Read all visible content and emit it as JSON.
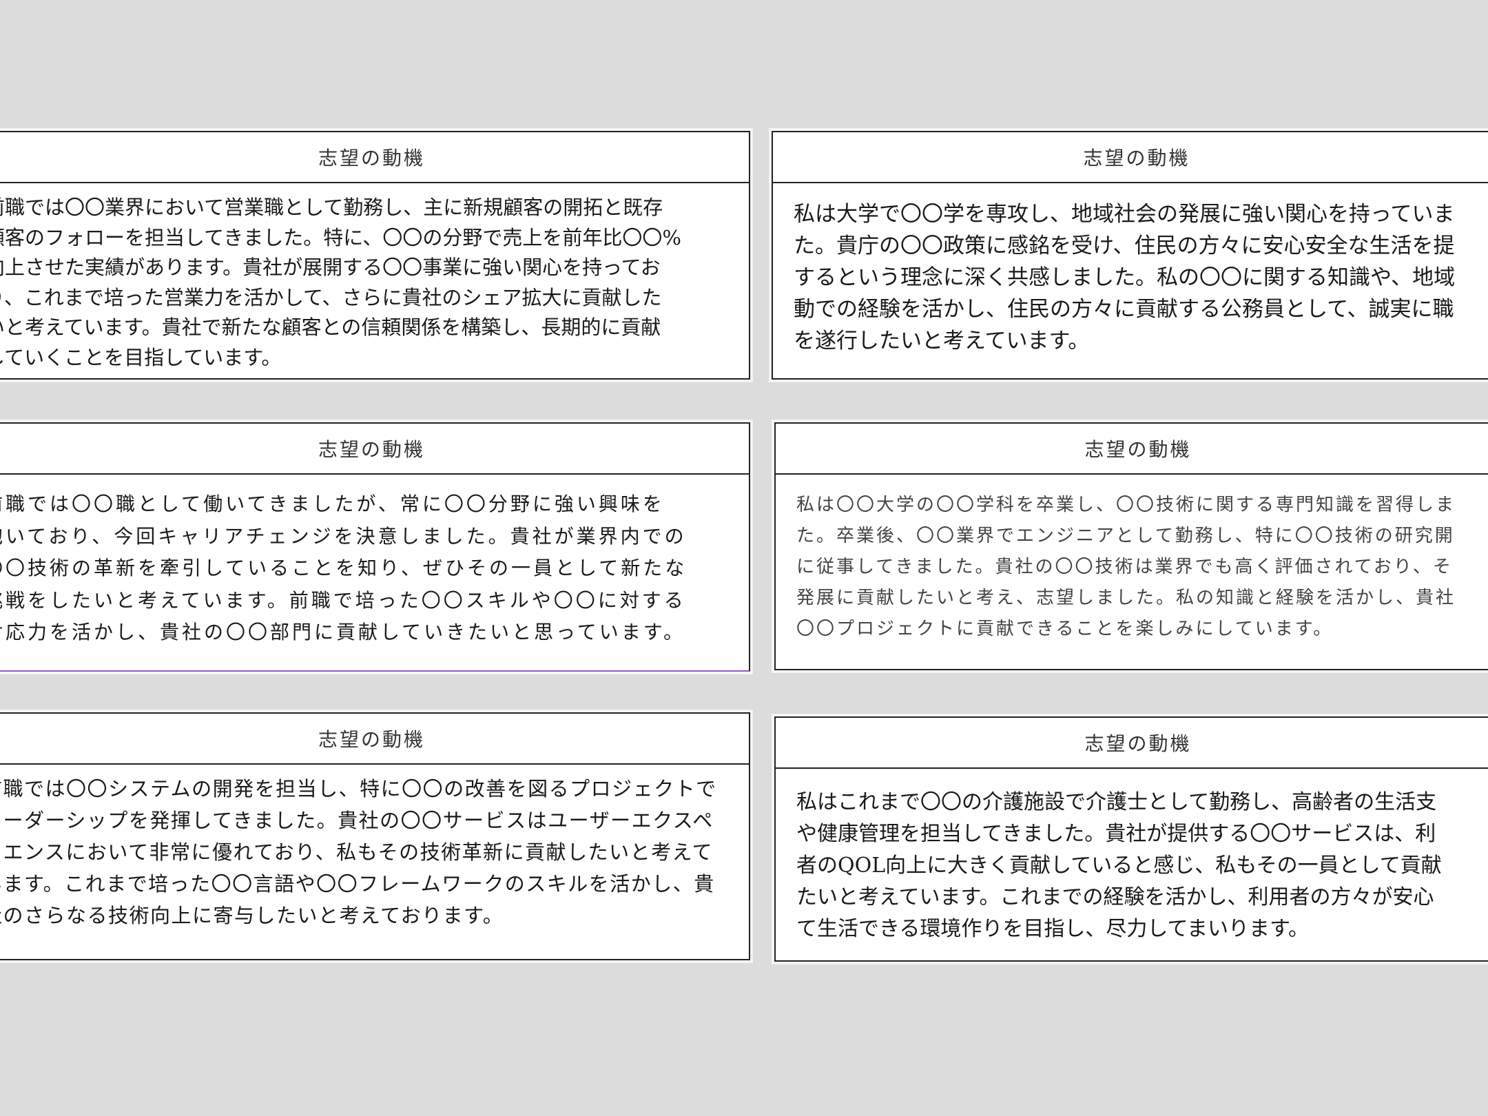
{
  "cards": [
    {
      "title": "志望の動機",
      "lines": [
        "前職では〇〇業界において営業職として勤務し、主に新規顧客の開拓と既存",
        "顧客のフォローを担当してきました。特に、〇〇の分野で売上を前年比〇〇%",
        "向上させた実績があります。貴社が展開する〇〇事業に強い関心を持ってお",
        "り、これまで培った営業力を活かして、さらに貴社のシェア拡大に貢献した",
        "いと考えています。貴社で新たな顧客との信頼関係を構築し、長期的に貢献",
        "していくことを目指しています。"
      ]
    },
    {
      "title": "志望の動機",
      "lines": [
        "私は大学で〇〇学を専攻し、地域社会の発展に強い関心を持っていま",
        "た。貴庁の〇〇政策に感銘を受け、住民の方々に安心安全な生活を提",
        "するという理念に深く共感しました。私の〇〇に関する知識や、地域",
        "動での経験を活かし、住民の方々に貢献する公務員として、誠実に職",
        "を遂行したいと考えています。"
      ]
    },
    {
      "title": "志望の動機",
      "lines": [
        "前職では〇〇職として働いてきましたが、常に〇〇分野に強い興味を",
        "抱いており、今回キャリアチェンジを決意しました。貴社が業界内での",
        "〇〇技術の革新を牽引していることを知り、ぜひその一員として新たな",
        "挑戦をしたいと考えています。前職で培った〇〇スキルや〇〇に対する",
        "対応力を活かし、貴社の〇〇部門に貢献していきたいと思っています。"
      ]
    },
    {
      "title": "志望の動機",
      "lines": [
        "私は〇〇大学の〇〇学科を卒業し、〇〇技術に関する専門知識を習得しま",
        "た。卒業後、〇〇業界でエンジニアとして勤務し、特に〇〇技術の研究開",
        "に従事してきました。貴社の〇〇技術は業界でも高く評価されており、そ",
        "発展に貢献したいと考え、志望しました。私の知識と経験を活かし、貴社",
        "〇〇プロジェクトに貢献できることを楽しみにしています。"
      ]
    },
    {
      "title": "志望の動機",
      "lines": [
        "前職では〇〇システムの開発を担当し、特に〇〇の改善を図るプロジェクトで",
        "リーダーシップを発揮してきました。貴社の〇〇サービスはユーザーエクスペ",
        "リエンスにおいて非常に優れており、私もその技術革新に貢献したいと考えて",
        "います。これまで培った〇〇言語や〇〇フレームワークのスキルを活かし、貴",
        "社のさらなる技術向上に寄与したいと考えております。"
      ]
    },
    {
      "title": "志望の動機",
      "lines": [
        "私はこれまで〇〇の介護施設で介護士として勤務し、高齢者の生活支",
        "や健康管理を担当してきました。貴社が提供する〇〇サービスは、利",
        "者のQOL向上に大きく貢献していると感じ、私もその一員として貢献",
        "たいと考えています。これまでの経験を活かし、利用者の方々が安心",
        "て生活できる環境作りを目指し、尽力してまいります。"
      ]
    }
  ]
}
